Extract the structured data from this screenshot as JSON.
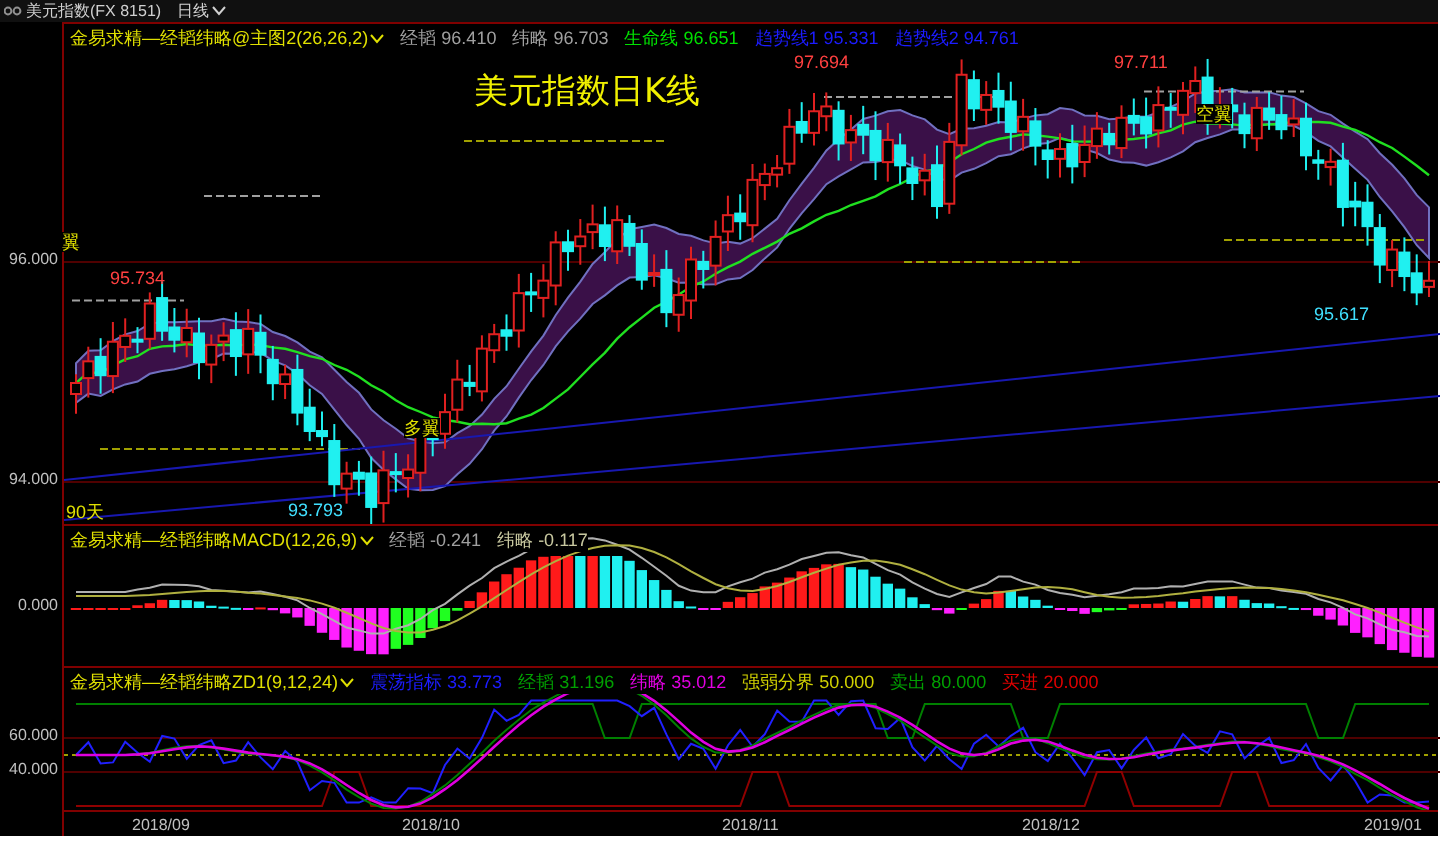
{
  "toolbar": {
    "symbol": "美元指数(FX 8151)",
    "period": "日线"
  },
  "main_chart": {
    "indicator": "金易求精—经韬纬略@主图2(26,26,2)",
    "readings": [
      {
        "text": "经韬 96.410",
        "color": "#a0a0a0"
      },
      {
        "text": "纬略 96.703",
        "color": "#a0a0a0"
      },
      {
        "text": "生命线 96.651",
        "color": "#00e000"
      },
      {
        "text": "趋势线1 95.331",
        "color": "#1c1cff"
      },
      {
        "text": "趋势线2 94.761",
        "color": "#1c1cff"
      }
    ],
    "title": "美元指数日K线",
    "y_axis": [
      "96.000",
      "94.000"
    ],
    "price_labels": [
      {
        "text": "95.734",
        "color": "#ff4040"
      },
      {
        "text": "97.694",
        "color": "#ff4040"
      },
      {
        "text": "97.711",
        "color": "#ff4040"
      },
      {
        "text": "95.617",
        "color": "#40e0ff"
      },
      {
        "text": "93.793",
        "color": "#40e0ff"
      }
    ],
    "signal_labels": [
      "翼",
      "多翼",
      "空翼"
    ],
    "period_label": "90天"
  },
  "macd": {
    "indicator": "金易求精—经韬纬略MACD(12,26,9)",
    "readings": [
      {
        "text": "经韬 -0.241",
        "color": "#a0a0a0"
      },
      {
        "text": "纬略 -0.117",
        "color": "#c8c8a0"
      }
    ],
    "y_axis": [
      "0.000"
    ]
  },
  "oscillator": {
    "indicator": "金易求精—经韬纬略ZD1(9,12,24)",
    "readings": [
      {
        "text": "震荡指标 33.773",
        "color": "#1c1cff"
      },
      {
        "text": "经韬 31.196",
        "color": "#00a000"
      },
      {
        "text": "纬略 35.012",
        "color": "#e000e0"
      },
      {
        "text": "强弱分界 50.000",
        "color": "#d0d000"
      },
      {
        "text": "卖出 80.000",
        "color": "#00a000"
      },
      {
        "text": "买进 20.000",
        "color": "#e00000"
      }
    ],
    "y_axis": [
      "60.000",
      "40.000"
    ]
  },
  "x_axis": [
    "2018/09",
    "2018/10",
    "2018/11",
    "2018/12",
    "2019/01"
  ]
}
